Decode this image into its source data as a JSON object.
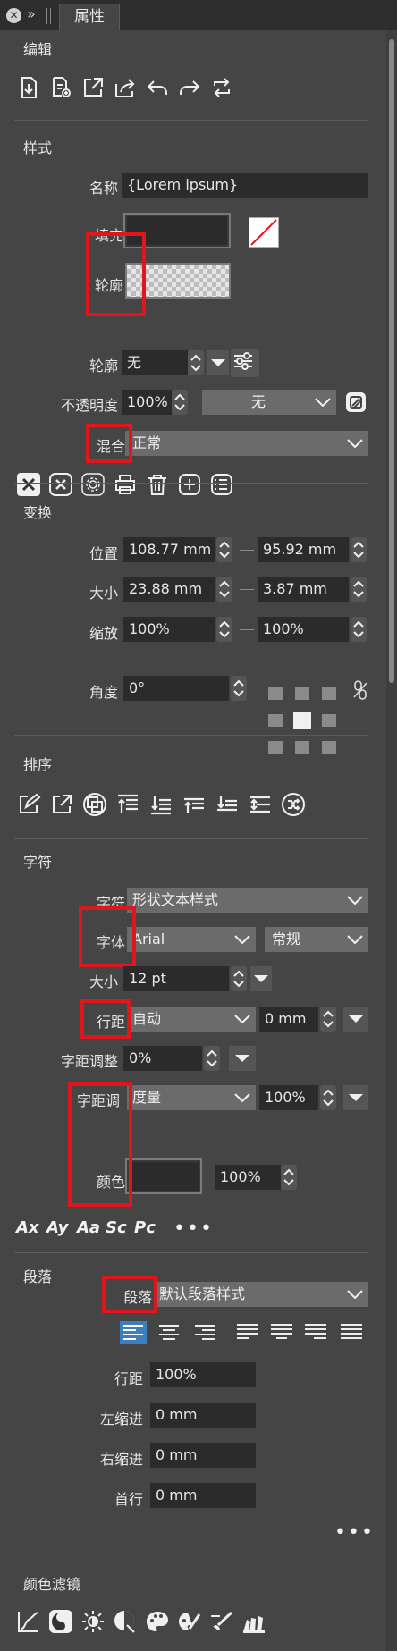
{
  "tabbar": {
    "close_icon": "close-icon",
    "collapse_icon": "double-chevron-icon",
    "tab_label": "属性"
  },
  "edit": {
    "title": "编辑",
    "icons": [
      "import-icon",
      "insert-file-icon",
      "export-icon",
      "share-icon",
      "undo-icon",
      "redo-icon",
      "refresh-icon"
    ]
  },
  "style": {
    "title": "样式",
    "name_label": "名称",
    "name_value": "{Lorem ipsum}",
    "fill_label": "填充",
    "stroke_label": "轮廓",
    "stroke2_label": "轮廓",
    "stroke_value": "无",
    "opacity_label": "不透明度",
    "opacity_value": "100%",
    "opacity_mode": "无",
    "blend_label": "混合",
    "blend_value": "正常",
    "toolbar_icons": [
      "clear-x-icon",
      "remove-circle-icon",
      "settings-icon",
      "print-icon",
      "trash-icon",
      "add-icon",
      "list-icon"
    ]
  },
  "transform": {
    "title": "变换",
    "position_label": "位置",
    "position_x": "108.77 mm",
    "position_y": "95.92 mm",
    "size_label": "大小",
    "size_w": "23.88 mm",
    "size_h": "3.87 mm",
    "scale_label": "缩放",
    "scale_x": "100%",
    "scale_y": "100%",
    "angle_label": "角度",
    "angle_value": "0°"
  },
  "arrange": {
    "title": "排序",
    "icons": [
      "edit-icon",
      "open-external-icon",
      "overlap-icon",
      "bring-front-icon",
      "send-back-icon",
      "bring-forward-icon",
      "send-backward-icon",
      "align-middle-icon",
      "swap-icon"
    ]
  },
  "character": {
    "title": "字符",
    "style_label": "字符",
    "style_value": "形状文本样式",
    "font_label": "字体",
    "font_value": "Arial",
    "font_weight": "常规",
    "size_label": "大小",
    "size_value": "12 pt",
    "leading_label": "行距",
    "leading_value": "自动",
    "leading_extra": "0 mm",
    "kerning_label": "字距调整",
    "kerning_value": "0%",
    "tracking_label": "字距调",
    "tracking_value": "度量",
    "tracking_percent": "100%",
    "color_label": "颜色",
    "color_percent": "100%",
    "effects": [
      "Ax",
      "Ay",
      "Aa",
      "Sc",
      "Pc"
    ],
    "more": "•••"
  },
  "paragraph": {
    "title": "段落",
    "style_label": "段落",
    "style_value": "默认段落样式",
    "leading_label": "行距",
    "leading_value": "100%",
    "left_indent_label": "左缩进",
    "left_indent_value": "0 mm",
    "right_indent_label": "右缩进",
    "right_indent_value": "0 mm",
    "first_line_label": "首行",
    "first_line_value": "0 mm",
    "more": "•••"
  },
  "color_filter": {
    "title": "颜色滤镜",
    "icons": [
      "curves-icon",
      "yin-yang-icon",
      "brightness-icon",
      "contrast-icon",
      "palette-icon",
      "palette-brush-icon",
      "brush-icon",
      "fan-icon"
    ]
  },
  "colors": {
    "accent_red": "#e0161d",
    "selected_align": "#3c7fc0"
  }
}
